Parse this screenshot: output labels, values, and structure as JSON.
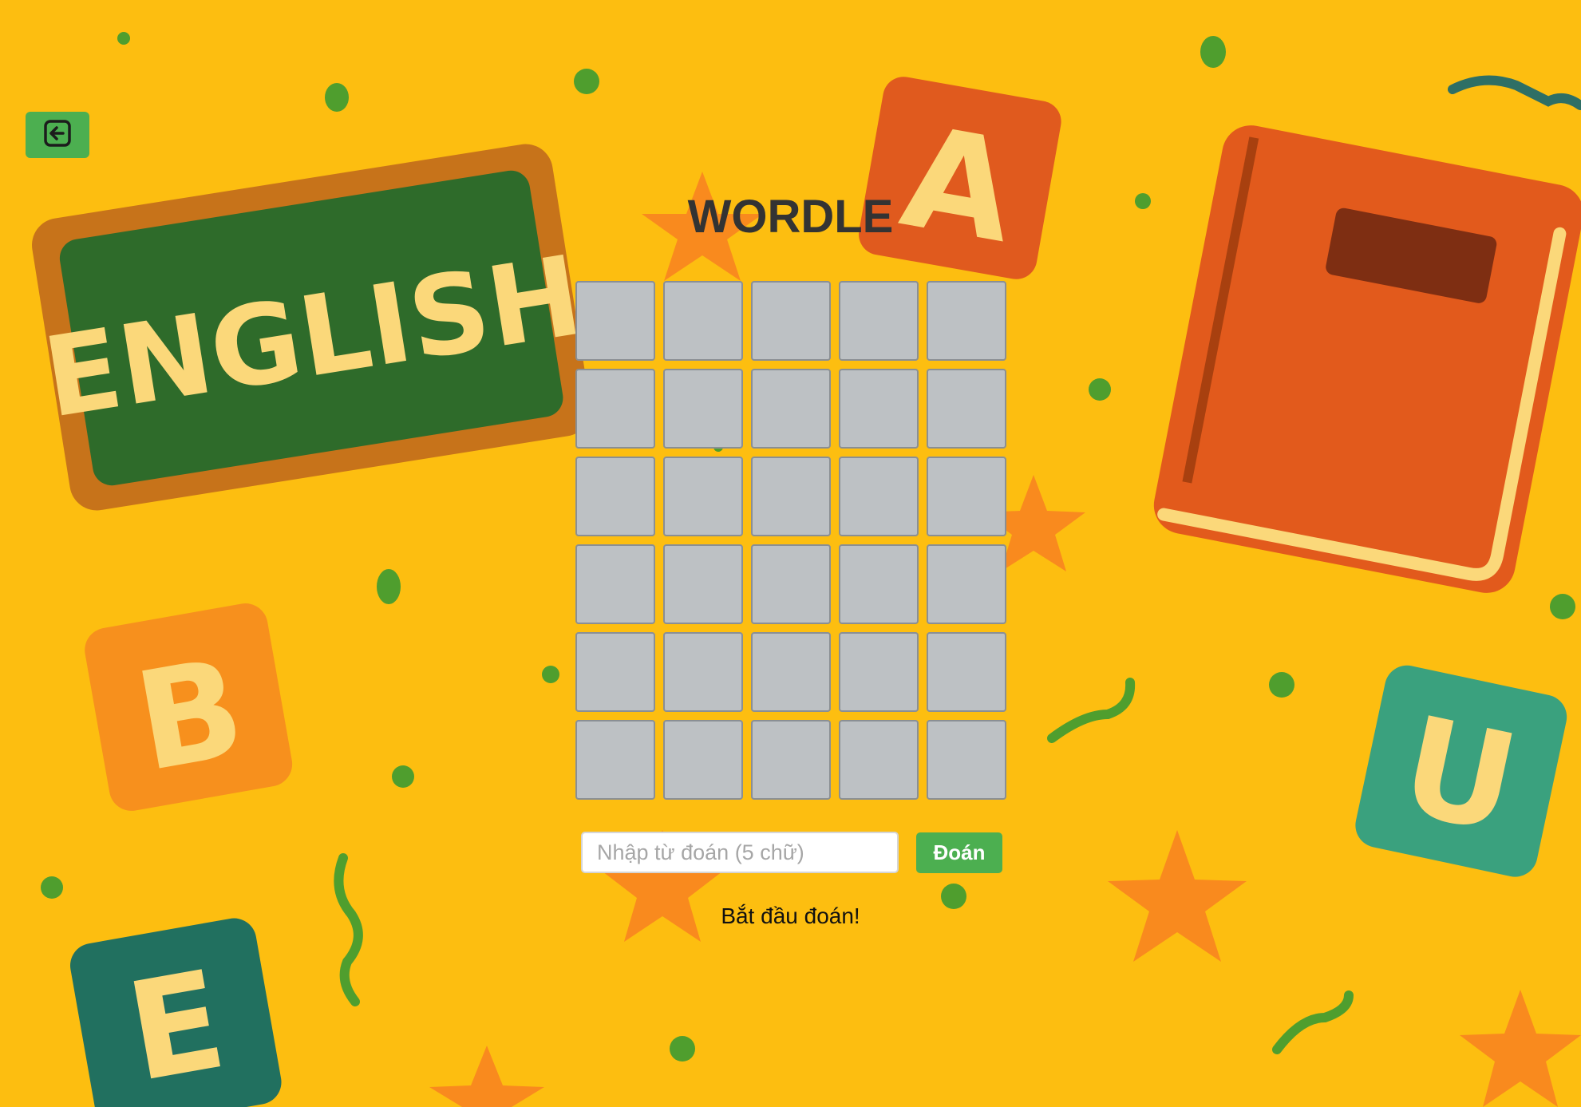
{
  "header": {
    "title": "WORDLE"
  },
  "background": {
    "board_text": "ENGLISH",
    "blocks": [
      "A",
      "B",
      "U",
      "E"
    ]
  },
  "board": {
    "rows": 6,
    "cols": 5,
    "letters": []
  },
  "input": {
    "placeholder": "Nhập từ đoán (5 chữ)",
    "value": ""
  },
  "guess_button": {
    "label": "Đoán"
  },
  "status": {
    "message": "Bắt đầu đoán!"
  },
  "icons": {
    "exit": "exit-icon"
  },
  "colors": {
    "background": "#FDBE10",
    "accent": "#4CAF50",
    "cell": "#BDC1C4"
  }
}
